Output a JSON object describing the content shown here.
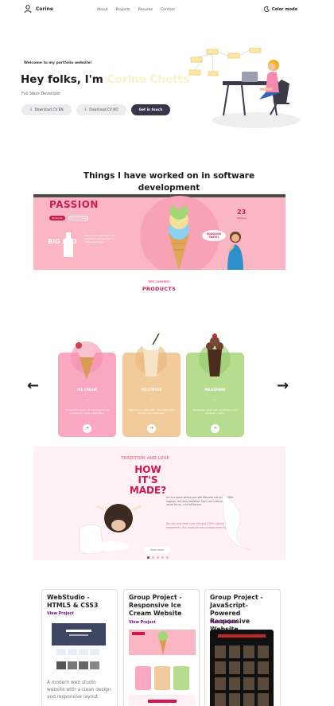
{
  "nav": {
    "brand": "Corine",
    "links": [
      "About",
      "Projects",
      "Resume",
      "Contact"
    ],
    "color_mode": "Color mode"
  },
  "hero": {
    "welcome": "Welcome to my portfolio website!",
    "greeting": "Hey folks, I'm",
    "greeting_faded": "Corine Chetts",
    "subtitle": "Full Stack Developer",
    "btn_cv_en": "Download CV EN",
    "btn_cv_ro": "Download CV RO",
    "btn_touch": "Get in touch"
  },
  "section_title": "Things I have worked on in software development",
  "slide1": {
    "headline": "PASSION",
    "btn_primary": "Products",
    "btn_secondary": "How it's made",
    "copy": "Simple Ice cream. All of the Ingredients are selected to make great taste.",
    "number": "23",
    "number_label": "Flavours",
    "bubble": "SOOOOOO TASTY!",
    "big_text": "BIG ECO"
  },
  "products": {
    "kicker": "THE CARAMEL",
    "title": "PRODUCTS",
    "cards": [
      {
        "title": "ICE CREAM",
        "desc": "Simple ice cream, all ingredients are selected to make great taste.",
        "color": "#f9a8c0"
      },
      {
        "title": "ICE COFFEE",
        "desc": "Natural ice coffee with chocolate taste to keep you refreshed.",
        "color": "#f1cb9a"
      },
      {
        "title": "MILKSHAKE",
        "desc": "Milkshake made with strawberry and whipped cream.",
        "color": "#b6dd8f"
      }
    ]
  },
  "how": {
    "kicker": "TRADITION AND LOVE",
    "title": "HOW IT'S MADE?",
    "p1": "Ice is a place where you will discover not only a little happier, but also healthier. Each ice is the main value for us, a lot of flavour.",
    "p2": "We use only fresh cow milk and 100% natural ingredients. Our products are available from May.",
    "read_more": "Read more"
  },
  "project_cards": [
    {
      "title": "WebStudio - HTML5 & CSS3",
      "view": "View Project",
      "desc": "A modern web studio website with a clean design and responsive layout."
    },
    {
      "title": "Group Project - Responsive Ice Cream Website",
      "view": "View Project"
    },
    {
      "title": "Group Project - JavaScript-Powered Responsive Website",
      "view": "View Project"
    }
  ],
  "colors": {
    "dark_button": "#36364a",
    "accent_pink": "#cc1b4e",
    "slide_bg": "#fbb6c4"
  }
}
